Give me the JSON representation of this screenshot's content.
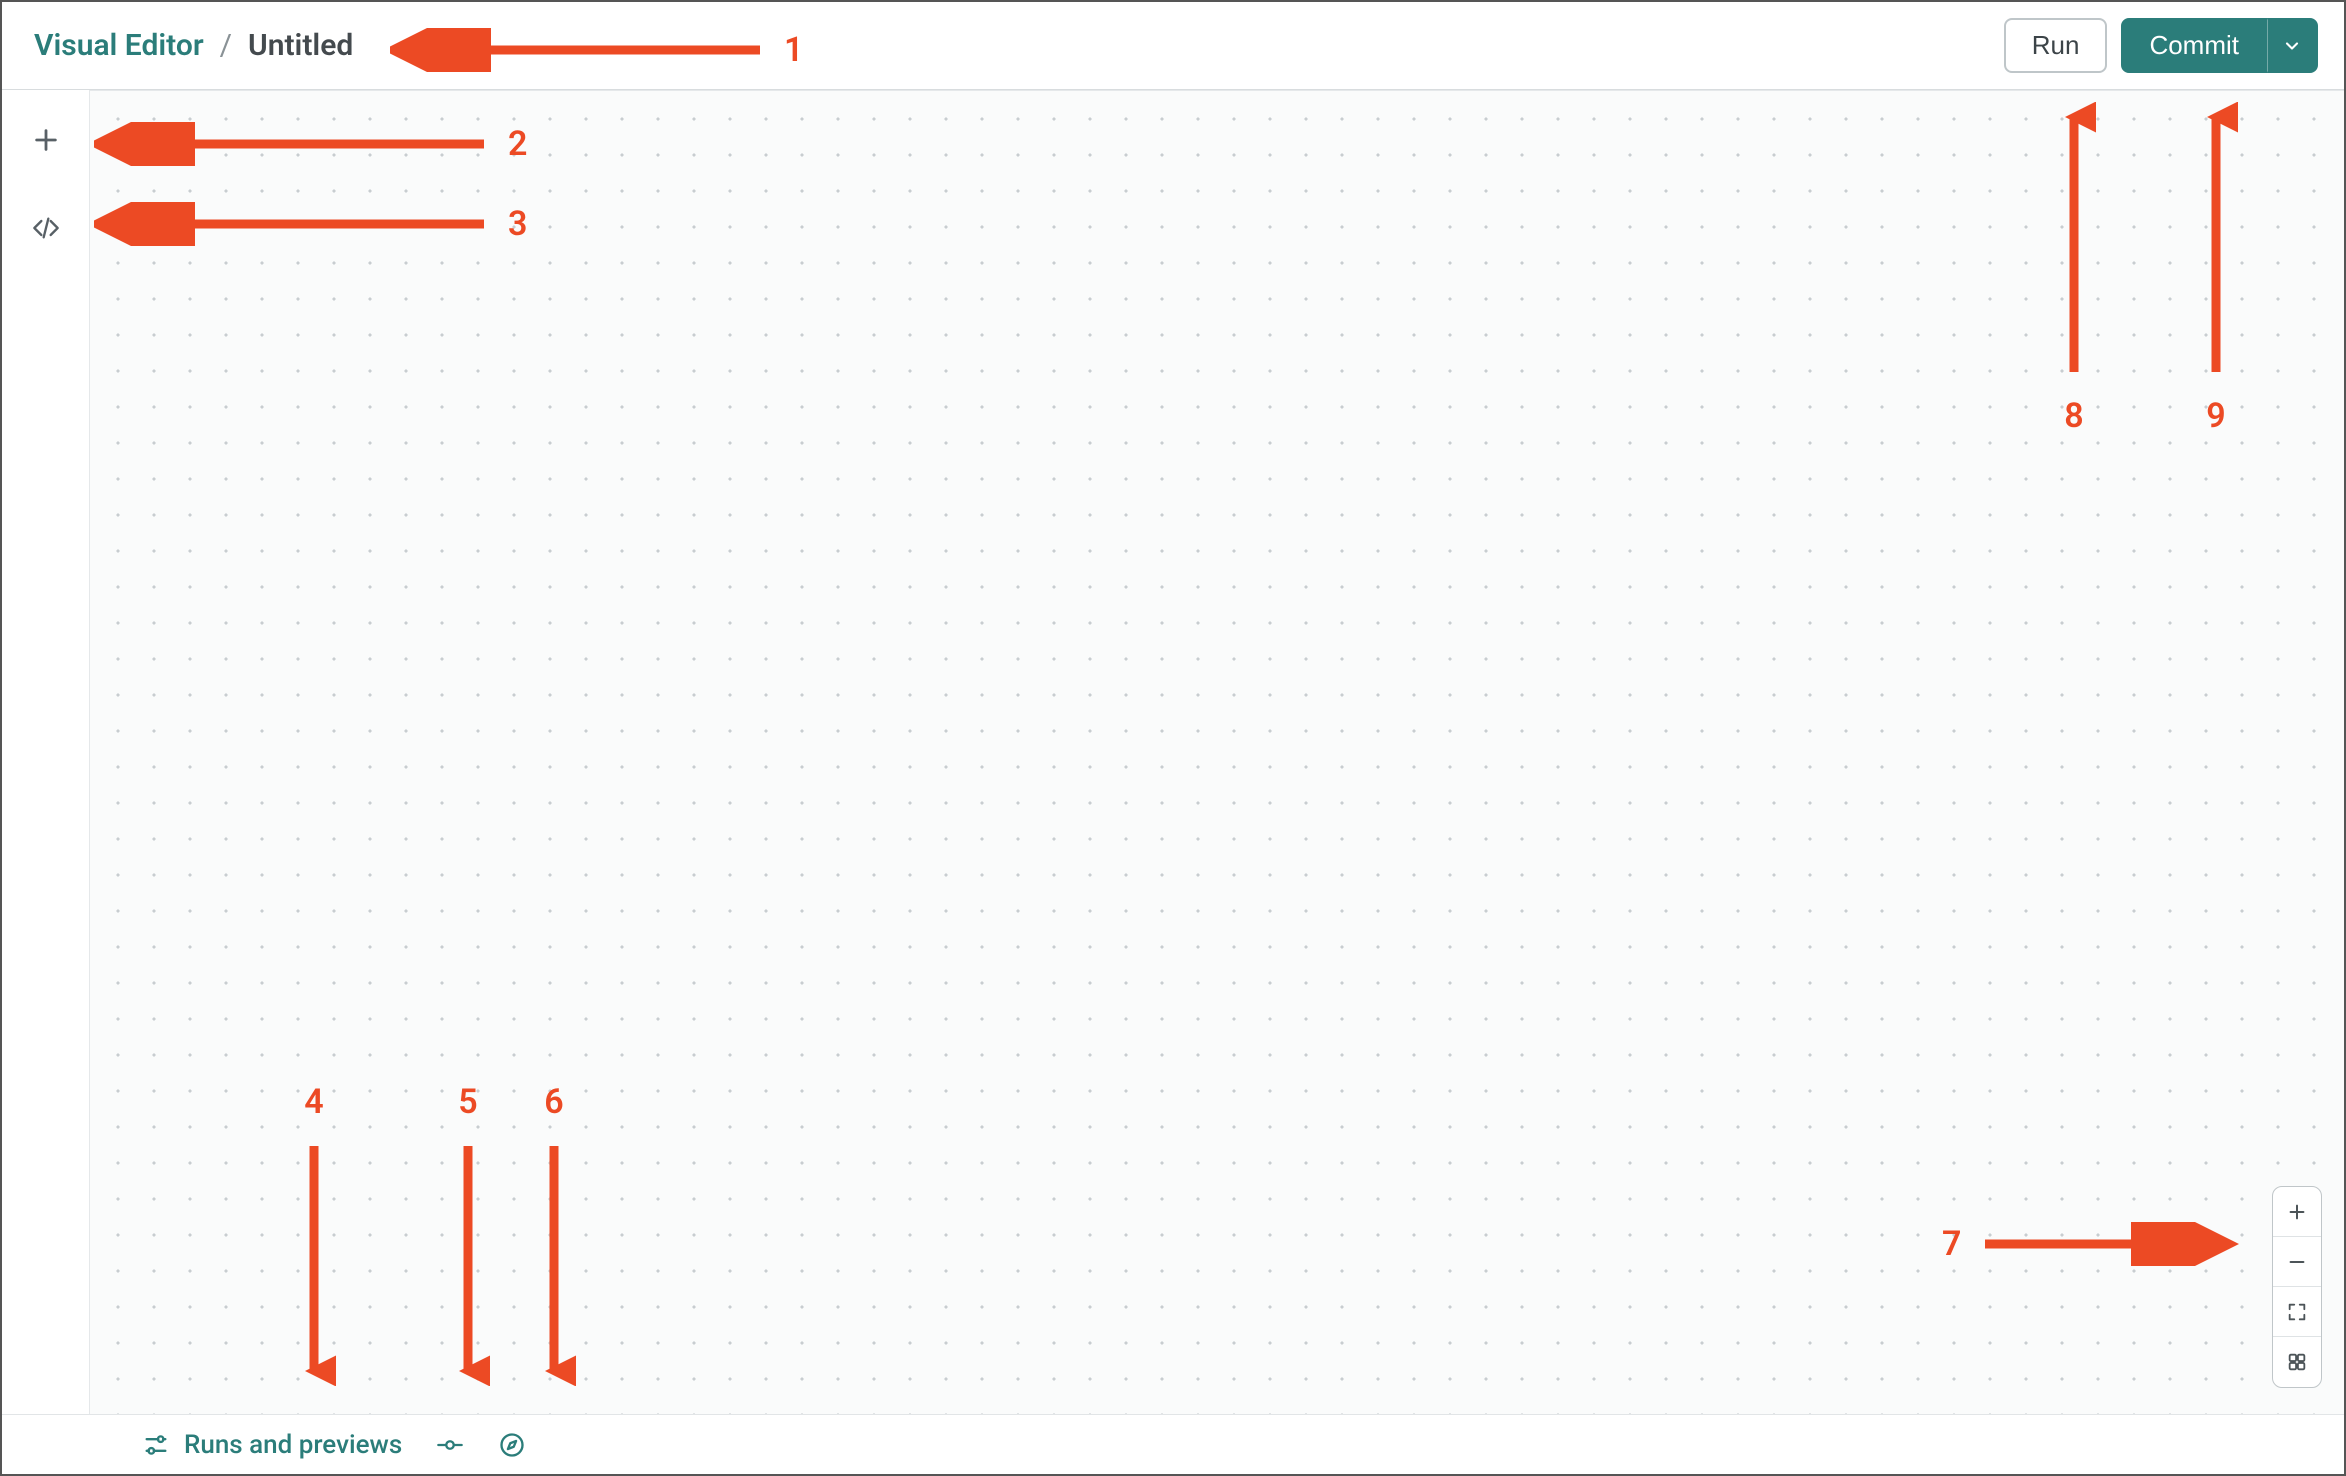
{
  "header": {
    "breadcrumb_root": "Visual Editor",
    "breadcrumb_separator": "/",
    "breadcrumb_leaf": "Untitled",
    "run_label": "Run",
    "commit_label": "Commit"
  },
  "left_rail": {
    "add_button": "add",
    "code_button": "code"
  },
  "zoom": {
    "in": "zoom-in",
    "out": "zoom-out",
    "fit": "fit-screen",
    "grid": "grid-view"
  },
  "footer": {
    "runs_label": "Runs and previews"
  },
  "annotations": {
    "n1": "1",
    "n2": "2",
    "n3": "3",
    "n4": "4",
    "n5": "5",
    "n6": "6",
    "n7": "7",
    "n8": "8",
    "n9": "9"
  }
}
